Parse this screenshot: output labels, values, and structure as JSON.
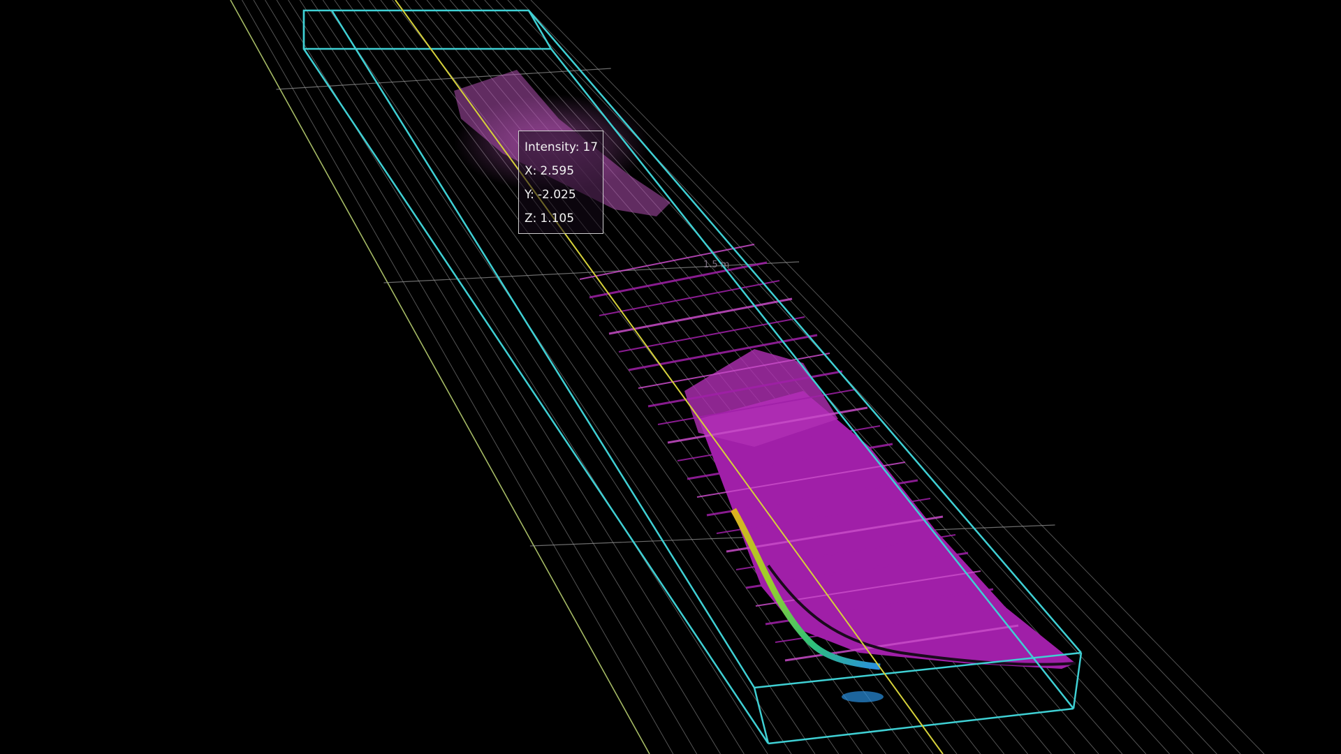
{
  "viewer": {
    "background_color": "#000000",
    "grid_color": "#9a9a9a",
    "box_color": "#3fd0d4",
    "axis_color": "#d6d23a",
    "point_color_primary": "#a020a8",
    "point_color_secondary": "#c84cc8"
  },
  "tooltip": {
    "intensity_label": "Intensity:",
    "intensity_value": "17",
    "x_label": "X:",
    "x_value": "2.595",
    "y_label": "Y:",
    "y_value": "-2.025",
    "z_label": "Z:",
    "z_value": "1.105"
  },
  "scene_label": "1.5 m"
}
